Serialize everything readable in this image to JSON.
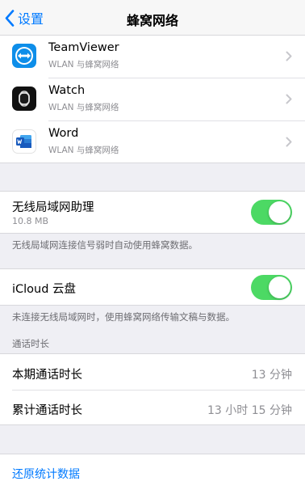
{
  "nav": {
    "back_label": "设置",
    "title": "蜂窝网络"
  },
  "apps": [
    {
      "name": "TeamViewer",
      "subtitle": "WLAN 与蜂窝网络",
      "icon": "teamviewer-icon"
    },
    {
      "name": "Watch",
      "subtitle": "WLAN 与蜂窝网络",
      "icon": "watch-icon"
    },
    {
      "name": "Word",
      "subtitle": "WLAN 与蜂窝网络",
      "icon": "word-icon"
    }
  ],
  "wifi_assist": {
    "title": "无线局域网助理",
    "usage": "10.8 MB",
    "enabled": true,
    "footnote": "无线局域网连接信号弱时自动使用蜂窝数据。"
  },
  "icloud": {
    "title": "iCloud 云盘",
    "enabled": true,
    "footnote": "未连接无线局域网时，使用蜂窝网络传输文稿与数据。"
  },
  "call_time": {
    "header": "通话时长",
    "rows": [
      {
        "label": "本期通话时长",
        "value": "13 分钟"
      },
      {
        "label": "累计通话时长",
        "value": "13 小时 15 分钟"
      }
    ]
  },
  "reset": {
    "label": "还原统计数据"
  },
  "colors": {
    "accent": "#007aff",
    "toggle_on": "#4cd964",
    "background": "#efeff4"
  }
}
